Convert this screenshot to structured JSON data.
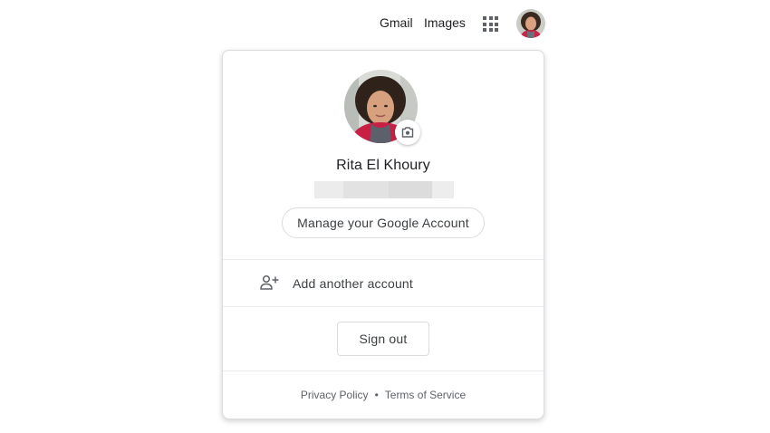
{
  "header": {
    "gmail_label": "Gmail",
    "images_label": "Images",
    "apps_icon": "apps-grid-icon"
  },
  "account": {
    "name": "Rita El Khoury",
    "manage_label": "Manage your Google Account",
    "camera_icon": "camera-icon"
  },
  "actions": {
    "add_account_label": "Add another account",
    "add_account_icon": "person-add-icon",
    "sign_out_label": "Sign out"
  },
  "footer": {
    "privacy_label": "Privacy Policy",
    "separator": "•",
    "terms_label": "Terms of Service"
  },
  "colors": {
    "text": "#202124",
    "secondary_text": "#5f6368",
    "border": "#dadce0"
  }
}
